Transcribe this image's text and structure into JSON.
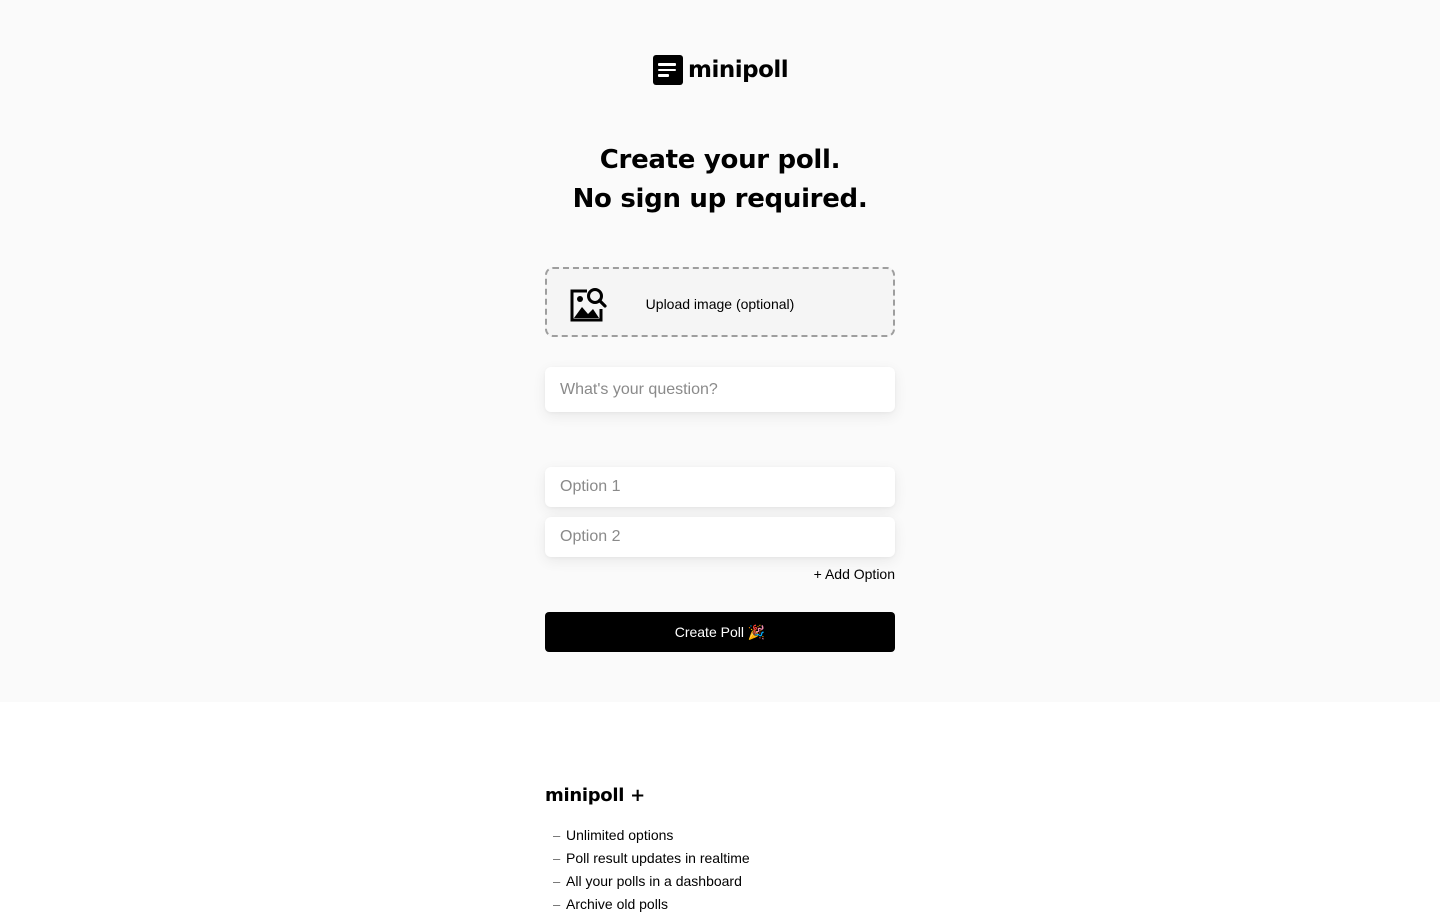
{
  "brand": {
    "name": "minipoll"
  },
  "headline": {
    "line1": "Create your poll.",
    "line2": "No sign up required."
  },
  "upload": {
    "label": "Upload image (optional)",
    "icon": "image-search-icon"
  },
  "form": {
    "question_placeholder": "What's your question?",
    "question_value": "",
    "options": [
      {
        "placeholder": "Option 1",
        "value": ""
      },
      {
        "placeholder": "Option 2",
        "value": ""
      }
    ],
    "add_option_label": "+ Add Option",
    "submit_label": "Create Poll 🎉"
  },
  "pro": {
    "title": "minipoll +",
    "features": [
      "Unlimited options",
      "Poll result updates in realtime",
      "All your polls in a dashboard",
      "Archive old polls"
    ],
    "bullet": "–"
  },
  "colors": {
    "hero_background": "#fafafa",
    "page_background": "#ffffff",
    "primary": "#000000",
    "button_text": "#ffffff",
    "placeholder": "#8a8a8a"
  }
}
